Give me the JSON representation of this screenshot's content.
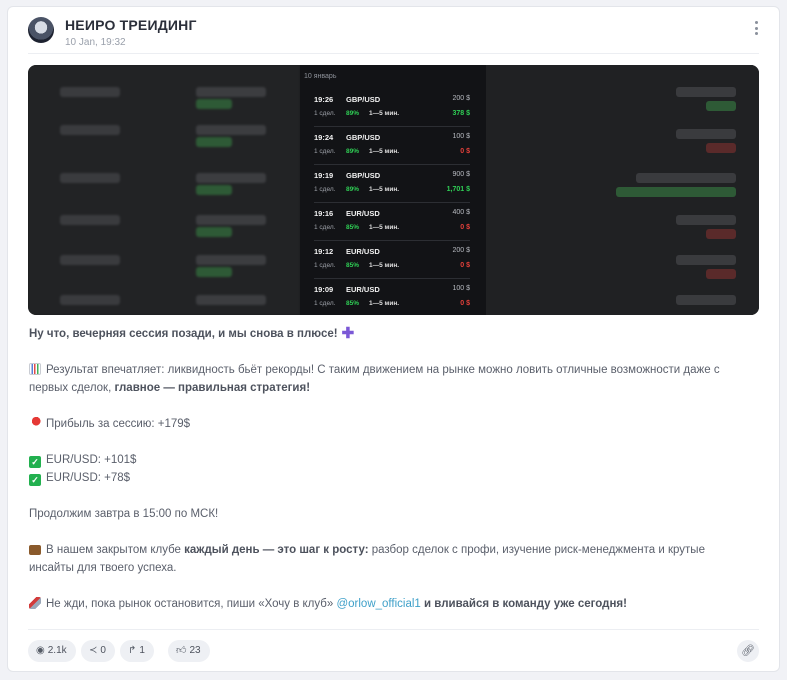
{
  "post": {
    "channel_name": "НЕИРО ТРЕИДИНГ",
    "date": "10 Jan, 19:32"
  },
  "screenshot": {
    "day_label": "10 январь",
    "trades": [
      {
        "time": "19:26",
        "pair": "GBP/USD",
        "amount": "200 $",
        "deals": "1 сдел.",
        "percent": "89%",
        "duration": "1—5 мин.",
        "result": "378 $",
        "result_color": "#2fcf55"
      },
      {
        "time": "19:24",
        "pair": "GBP/USD",
        "amount": "100 $",
        "deals": "1 сдел.",
        "percent": "89%",
        "duration": "1—5 мин.",
        "result": "0 $",
        "result_color": "#e5403a"
      },
      {
        "time": "19:19",
        "pair": "GBP/USD",
        "amount": "900 $",
        "deals": "1 сдел.",
        "percent": "89%",
        "duration": "1—5 мин.",
        "result": "1,701 $",
        "result_color": "#2fcf55"
      },
      {
        "time": "19:16",
        "pair": "EUR/USD",
        "amount": "400 $",
        "deals": "1 сдел.",
        "percent": "85%",
        "duration": "1—5 мин.",
        "result": "0 $",
        "result_color": "#e5403a"
      },
      {
        "time": "19:12",
        "pair": "EUR/USD",
        "amount": "200 $",
        "deals": "1 сдел.",
        "percent": "85%",
        "duration": "1—5 мин.",
        "result": "0 $",
        "result_color": "#e5403a"
      },
      {
        "time": "19:09",
        "pair": "EUR/USD",
        "amount": "100 $",
        "deals": "1 сдел.",
        "percent": "85%",
        "duration": "1—5 мин.",
        "result": "0 $",
        "result_color": "#e5403a"
      }
    ]
  },
  "text": {
    "line1": "Ну что, вечерняя сессия позади, и мы снова в плюсе!",
    "p2_a": "Результат впечатляет: ликвидность бьёт рекорды! С таким движением на рынке можно ловить отличные возможности даже с первых сделок, ",
    "p2_b": "главное — правильная стратегия!",
    "p3": "Прибыль за сессию: +179$",
    "p4_1": "EUR/USD: +101$",
    "p4_2": "EUR/USD: +78$",
    "p5": "Продолжим завтра в 15:00 по МСК!",
    "p6_a": "В нашем закрытом клубе ",
    "p6_b": "каждый день — это шаг к росту:",
    "p6_c": " разбор сделок с профи, изучение риск-менеджмента и крутые инсайты для твоего успеха.",
    "p7_a": "Не жди, пока рынок остановится, пиши «Хочу в клуб» ",
    "p7_link": "@orlow_official1",
    "p7_b": " и вливайся в команду уже сегодня!"
  },
  "footer": {
    "views": "2.1k",
    "shares": "0",
    "forwards": "1",
    "likes": "23"
  }
}
